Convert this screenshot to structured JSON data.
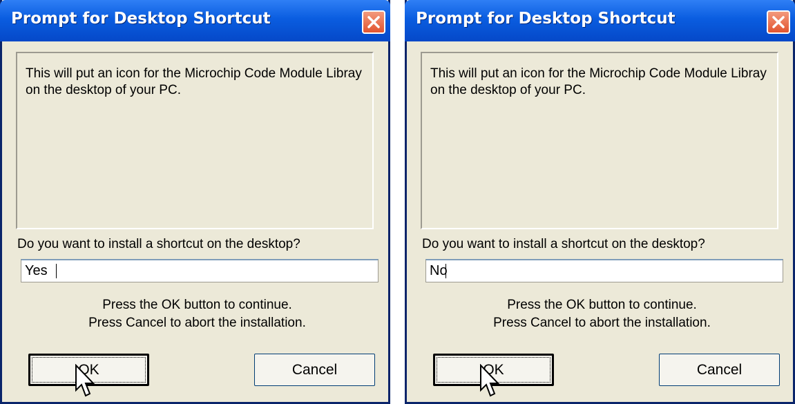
{
  "dialogs": [
    {
      "title": "Prompt for Desktop Shortcut",
      "message": "This will put an icon for the Microchip Code Module Libray on the desktop of your PC.",
      "question": "Do you want to install a shortcut on the desktop?",
      "answer_value": "Yes",
      "instruction_1": "Press the OK button to continue.",
      "instruction_2": "Press Cancel to abort the installation.",
      "ok_label": "OK",
      "cancel_label": "Cancel"
    },
    {
      "title": "Prompt for Desktop Shortcut",
      "message": "This will put an icon for the Microchip Code Module Libray on the desktop of your PC.",
      "question": "Do you want to install a shortcut on the desktop?",
      "answer_value": "No",
      "instruction_1": "Press the OK button to continue.",
      "instruction_2": "Press Cancel to abort the installation.",
      "ok_label": "OK",
      "cancel_label": "Cancel"
    }
  ],
  "icons": {
    "close": "close-x-icon",
    "cursor": "mouse-pointer-icon"
  },
  "colors": {
    "titlebar": "#0a5de0",
    "dialog_bg": "#ece9d8",
    "close_button": "#e2542f"
  }
}
